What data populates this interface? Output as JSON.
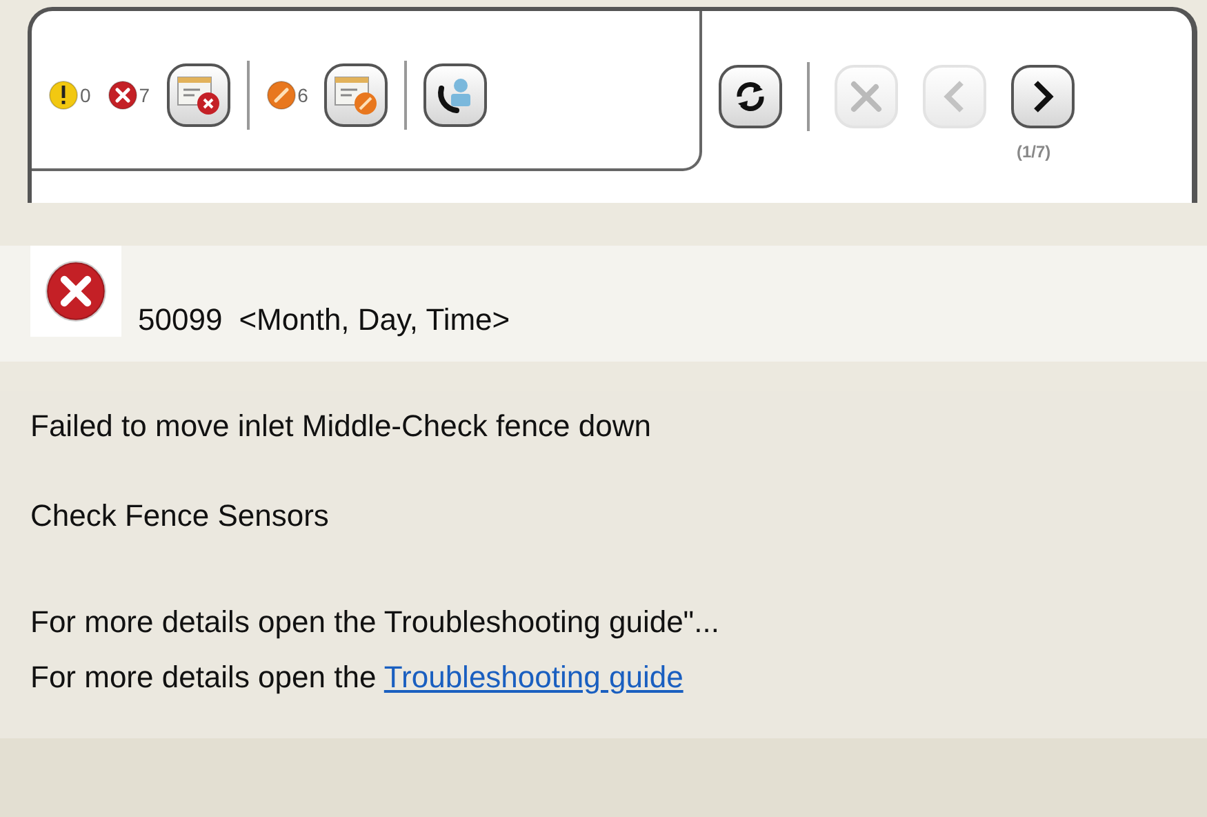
{
  "toolbar": {
    "counters": [
      {
        "kind": "warning",
        "count": "0"
      },
      {
        "kind": "error",
        "count": "7"
      },
      {
        "kind": "maintenance",
        "count": "6"
      }
    ],
    "buttons": [
      {
        "disabled": false
      },
      {
        "disabled": false
      },
      {
        "disabled": false
      },
      {
        "disabled": false
      },
      {
        "disabled": true
      },
      {
        "disabled": true
      },
      {
        "disabled": false
      }
    ],
    "page": "(1/7)"
  },
  "message": {
    "kind": "error",
    "code": "50099",
    "timestamp": "<Month, Day, Time>",
    "lines": [
      "Failed to move inlet Middle-Check fence down",
      "Check Fence Sensors"
    ],
    "details": [
      {
        "text": "For more details open the Troubleshooting guide\"..."
      },
      {
        "text": "For more details open the ",
        "link": "Troubleshooting guide"
      }
    ]
  }
}
